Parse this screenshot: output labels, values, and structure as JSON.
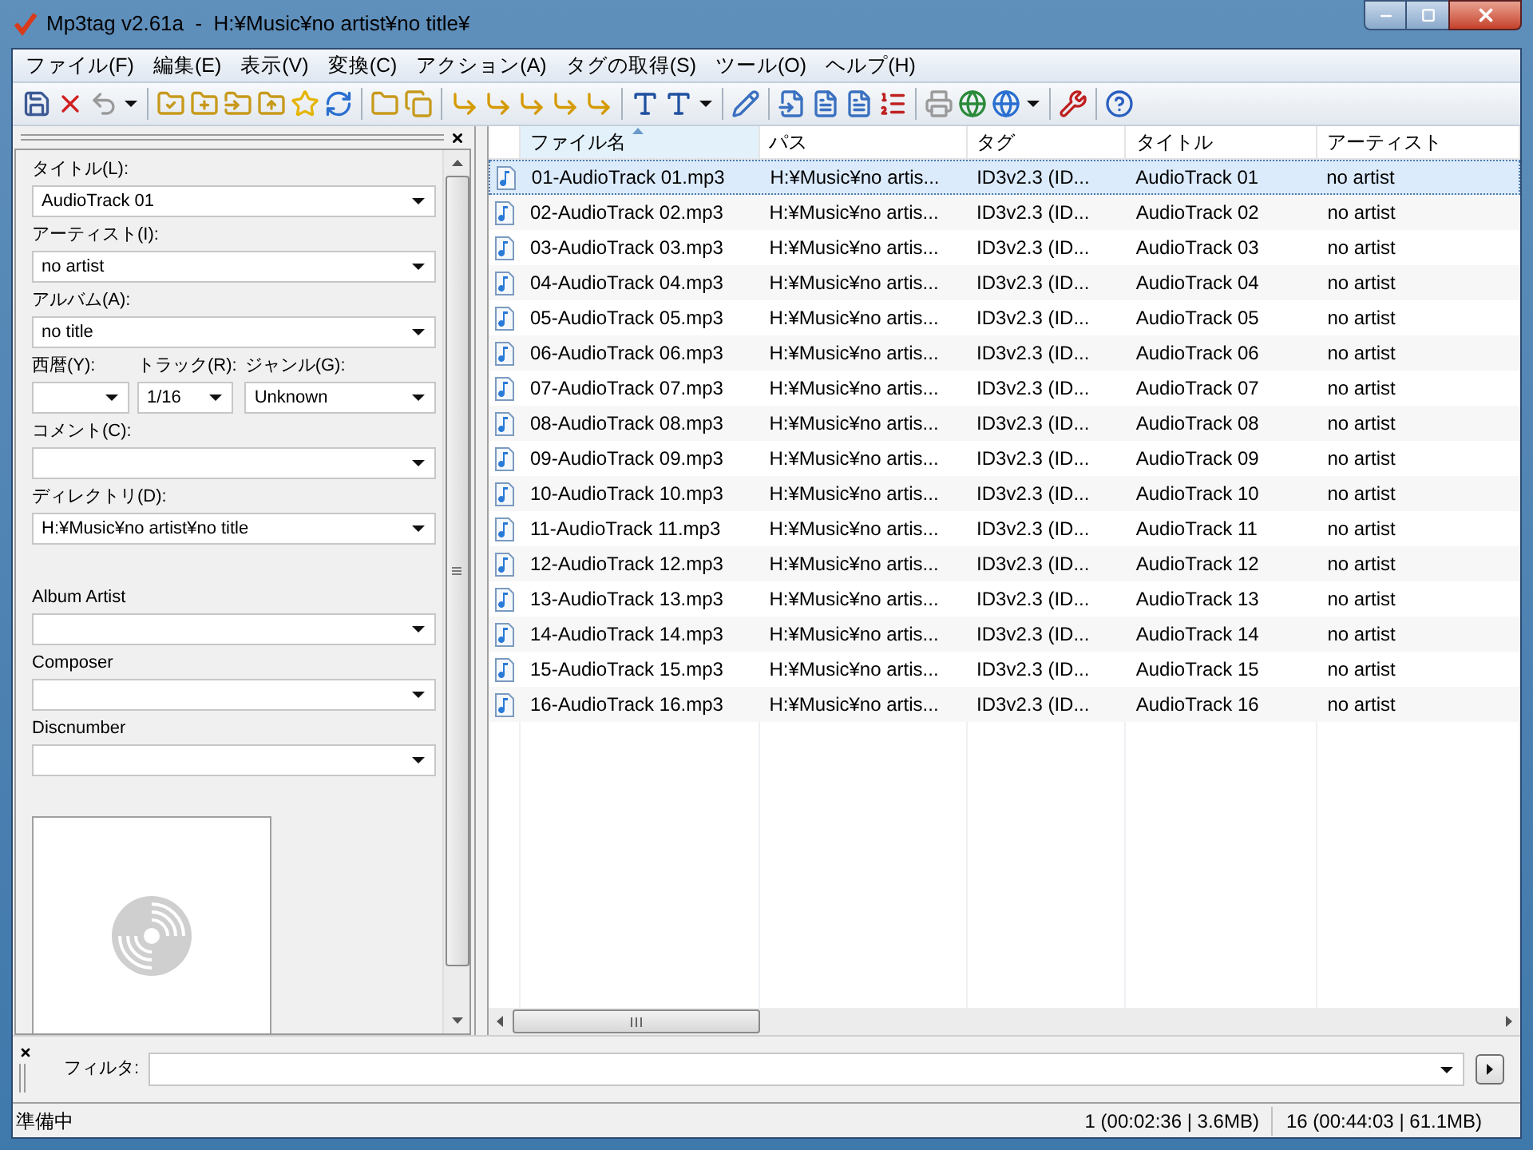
{
  "window": {
    "title": "Mp3tag v2.61a  -  H:¥Music¥no artist¥no title¥"
  },
  "menu": [
    "ファイル(F)",
    "編集(E)",
    "表示(V)",
    "変換(C)",
    "アクション(A)",
    "タグの取得(S)",
    "ツール(O)",
    "ヘルプ(H)"
  ],
  "tag_panel": {
    "fields": [
      {
        "kind": "combo",
        "label": "タイトル(L):",
        "value": "AudioTrack 01"
      },
      {
        "kind": "combo",
        "label": "アーティスト(I):",
        "value": "no artist"
      },
      {
        "kind": "combo",
        "label": "アルバム(A):",
        "value": "no title"
      },
      {
        "kind": "row",
        "items": [
          {
            "label": "西暦(Y):"
          },
          {
            "label": "トラック(R):",
            "value": "1/16"
          },
          {
            "label": "ジャンル(G):",
            "value": "Unknown"
          }
        ]
      },
      {
        "kind": "combo",
        "label": "コメント(C):"
      },
      {
        "kind": "combo",
        "label": "ディレクトリ(D):",
        "value": "H:¥Music¥no artist¥no title"
      },
      {
        "kind": "separator"
      },
      {
        "kind": "combo",
        "label": "Album Artist"
      },
      {
        "kind": "combo",
        "label": "Composer"
      },
      {
        "kind": "combo",
        "label": "Discnumber"
      }
    ]
  },
  "file_list": {
    "columns": [
      {
        "label": "ファイル名",
        "sorted": true
      },
      {
        "label": "パス",
        "sorted": false
      },
      {
        "label": "タグ",
        "sorted": false
      },
      {
        "label": "タイトル",
        "sorted": false
      },
      {
        "label": "アーティスト",
        "sorted": false
      }
    ],
    "rows": [
      {
        "selected": true,
        "cells": [
          "01-AudioTrack 01.mp3",
          "H:¥Music¥no artis...",
          "ID3v2.3 (ID...",
          "AudioTrack 01",
          "no artist"
        ]
      },
      {
        "selected": false,
        "cells": [
          "02-AudioTrack 02.mp3",
          "H:¥Music¥no artis...",
          "ID3v2.3 (ID...",
          "AudioTrack 02",
          "no artist"
        ]
      },
      {
        "selected": false,
        "cells": [
          "03-AudioTrack 03.mp3",
          "H:¥Music¥no artis...",
          "ID3v2.3 (ID...",
          "AudioTrack 03",
          "no artist"
        ]
      },
      {
        "selected": false,
        "cells": [
          "04-AudioTrack 04.mp3",
          "H:¥Music¥no artis...",
          "ID3v2.3 (ID...",
          "AudioTrack 04",
          "no artist"
        ]
      },
      {
        "selected": false,
        "cells": [
          "05-AudioTrack 05.mp3",
          "H:¥Music¥no artis...",
          "ID3v2.3 (ID...",
          "AudioTrack 05",
          "no artist"
        ]
      },
      {
        "selected": false,
        "cells": [
          "06-AudioTrack 06.mp3",
          "H:¥Music¥no artis...",
          "ID3v2.3 (ID...",
          "AudioTrack 06",
          "no artist"
        ]
      },
      {
        "selected": false,
        "cells": [
          "07-AudioTrack 07.mp3",
          "H:¥Music¥no artis...",
          "ID3v2.3 (ID...",
          "AudioTrack 07",
          "no artist"
        ]
      },
      {
        "selected": false,
        "cells": [
          "08-AudioTrack 08.mp3",
          "H:¥Music¥no artis...",
          "ID3v2.3 (ID...",
          "AudioTrack 08",
          "no artist"
        ]
      },
      {
        "selected": false,
        "cells": [
          "09-AudioTrack 09.mp3",
          "H:¥Music¥no artis...",
          "ID3v2.3 (ID...",
          "AudioTrack 09",
          "no artist"
        ]
      },
      {
        "selected": false,
        "cells": [
          "10-AudioTrack 10.mp3",
          "H:¥Music¥no artis...",
          "ID3v2.3 (ID...",
          "AudioTrack 10",
          "no artist"
        ]
      },
      {
        "selected": false,
        "cells": [
          "11-AudioTrack 11.mp3",
          "H:¥Music¥no artis...",
          "ID3v2.3 (ID...",
          "AudioTrack 11",
          "no artist"
        ]
      },
      {
        "selected": false,
        "cells": [
          "12-AudioTrack 12.mp3",
          "H:¥Music¥no artis...",
          "ID3v2.3 (ID...",
          "AudioTrack 12",
          "no artist"
        ]
      },
      {
        "selected": false,
        "cells": [
          "13-AudioTrack 13.mp3",
          "H:¥Music¥no artis...",
          "ID3v2.3 (ID...",
          "AudioTrack 13",
          "no artist"
        ]
      },
      {
        "selected": false,
        "cells": [
          "14-AudioTrack 14.mp3",
          "H:¥Music¥no artis...",
          "ID3v2.3 (ID...",
          "AudioTrack 14",
          "no artist"
        ]
      },
      {
        "selected": false,
        "cells": [
          "15-AudioTrack 15.mp3",
          "H:¥Music¥no artis...",
          "ID3v2.3 (ID...",
          "AudioTrack 15",
          "no artist"
        ]
      },
      {
        "selected": false,
        "cells": [
          "16-AudioTrack 16.mp3",
          "H:¥Music¥no artis...",
          "ID3v2.3 (ID...",
          "AudioTrack 16",
          "no artist"
        ]
      }
    ]
  },
  "filter": {
    "label": "フィルタ:"
  },
  "status_bar": {
    "message": "準備中",
    "selection": "1 (00:02:36 | 3.6MB)",
    "total": "16 (00:44:03 | 61.1MB)"
  }
}
